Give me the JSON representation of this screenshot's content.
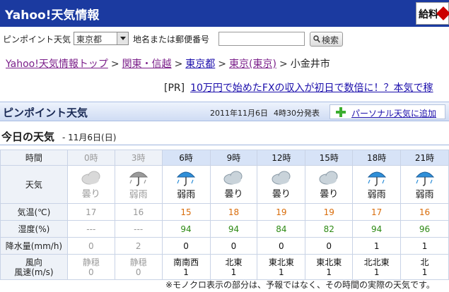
{
  "header": {
    "title": "Yahoo!天気情報",
    "ad_text": "給料"
  },
  "search": {
    "pinpoint_label": "ピンポイント天気",
    "prefecture_value": "東京都",
    "place_label": "地名または郵便番号",
    "input_value": "",
    "search_button": "検索"
  },
  "breadcrumb": {
    "items": [
      "Yahoo!天気情報トップ",
      "関東・信越",
      "東京都",
      "東京(東京)"
    ],
    "separator": ">",
    "current": "小金井市"
  },
  "pr": {
    "tag": "[PR]",
    "link": "10万円で始めたFXの収入が初日で数倍に！？本気で稼"
  },
  "pinpoint": {
    "title": "ピンポイント天気",
    "date": "2011年11月6日",
    "time": "4時30分発表",
    "add_link": "パーソナル天気に追加"
  },
  "today": {
    "heading": "今日の天気",
    "date": "- 11月6日(日)"
  },
  "table": {
    "labels": {
      "time": "時間",
      "weather": "天気",
      "temp": "気温(℃)",
      "humidity": "湿度(%)",
      "precip": "降水量(mm/h)",
      "wind_dir": "風向",
      "wind_speed": "風速(m/s)"
    },
    "hours": [
      {
        "time": "0時",
        "past": true,
        "weather": "曇り",
        "icon": "cloud-icon",
        "temp": "17",
        "humidity": "---",
        "precip": "0",
        "wind_dir": "静穏",
        "wind_speed": "0"
      },
      {
        "time": "3時",
        "past": true,
        "weather": "弱雨",
        "icon": "umbrella-icon",
        "temp": "16",
        "humidity": "---",
        "precip": "2",
        "wind_dir": "静穏",
        "wind_speed": "0"
      },
      {
        "time": "6時",
        "past": false,
        "weather": "弱雨",
        "icon": "umbrella-icon",
        "temp": "15",
        "humidity": "94",
        "precip": "0",
        "wind_dir": "南南西",
        "wind_speed": "1"
      },
      {
        "time": "9時",
        "past": false,
        "weather": "曇り",
        "icon": "cloud-icon",
        "temp": "18",
        "humidity": "94",
        "precip": "0",
        "wind_dir": "北東",
        "wind_speed": "1"
      },
      {
        "time": "12時",
        "past": false,
        "weather": "曇り",
        "icon": "cloud-icon",
        "temp": "19",
        "humidity": "84",
        "precip": "0",
        "wind_dir": "東北東",
        "wind_speed": "1"
      },
      {
        "time": "15時",
        "past": false,
        "weather": "曇り",
        "icon": "cloud-icon",
        "temp": "19",
        "humidity": "82",
        "precip": "0",
        "wind_dir": "東北東",
        "wind_speed": "1"
      },
      {
        "time": "18時",
        "past": false,
        "weather": "弱雨",
        "icon": "umbrella-icon",
        "temp": "17",
        "humidity": "94",
        "precip": "1",
        "wind_dir": "北北東",
        "wind_speed": "1"
      },
      {
        "time": "21時",
        "past": false,
        "weather": "弱雨",
        "icon": "umbrella-icon",
        "temp": "16",
        "humidity": "96",
        "precip": "1",
        "wind_dir": "北",
        "wind_speed": "1"
      }
    ]
  },
  "note": "※モノクロ表示の部分は、予報ではなく、その時間の実際の天気です。",
  "colors": {
    "header_bg": "#1b3aa0",
    "temp": "#d96c0a",
    "humidity": "#2e8a15",
    "link": "#1a0dab"
  }
}
